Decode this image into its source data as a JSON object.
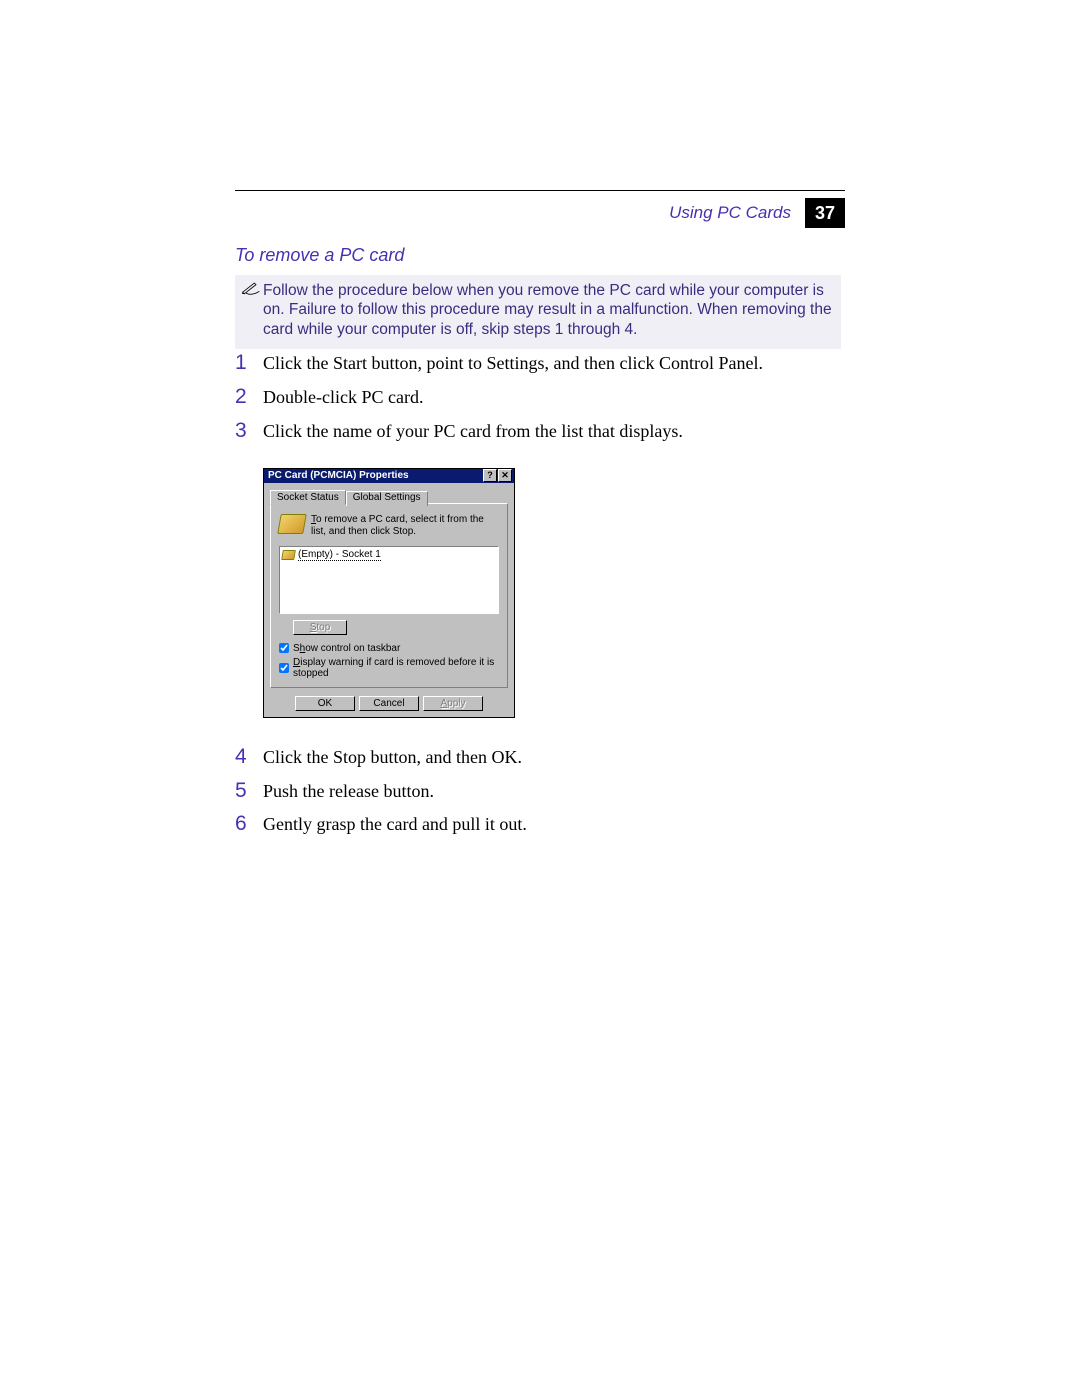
{
  "header": {
    "chapter": "Using PC Cards",
    "page_number": "37"
  },
  "section_title": "To remove a PC card",
  "note_text": "Follow the procedure below when you remove the PC card while your computer is on. Failure to follow this procedure may result in a malfunction. When removing the card while your computer is off, skip steps 1 through 4.",
  "steps": [
    {
      "n": "1",
      "t": "Click the Start button, point to Settings, and then click Control Panel."
    },
    {
      "n": "2",
      "t": "Double-click PC card."
    },
    {
      "n": "3",
      "t": "Click the name of your PC card from the list that displays."
    },
    {
      "n": "4",
      "t": "Click the Stop button, and then OK."
    },
    {
      "n": "5",
      "t": "Push the release button."
    },
    {
      "n": "6",
      "t": "Gently grasp the card and pull it out."
    }
  ],
  "dialog": {
    "title": "PC Card (PCMCIA) Properties",
    "tabs": {
      "active": "Socket Status",
      "inactive": "Global Settings"
    },
    "instruction_prefix": "T",
    "instruction_rest": "o remove a PC card, select it from the list, and then click Stop.",
    "list_item": "(Empty) - Socket 1",
    "stop_prefix": "S",
    "stop_rest": "top",
    "check1_prefix": "S",
    "check1_mid": "h",
    "check1_rest": "ow control on taskbar",
    "check2_prefix": "D",
    "check2_rest": "isplay warning if card is removed before it is stopped",
    "buttons": {
      "ok": "OK",
      "cancel": "Cancel",
      "apply_prefix": "A",
      "apply_rest": "pply"
    }
  }
}
